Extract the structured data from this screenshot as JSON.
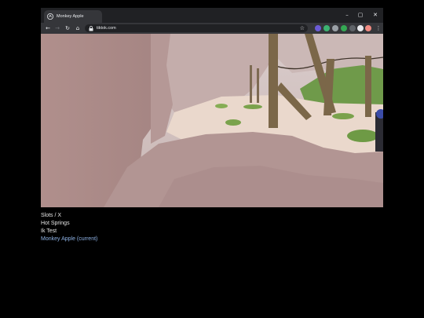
{
  "browser": {
    "tab": {
      "title": "Monkey Apple",
      "icon": "tiktok-icon"
    },
    "window_controls": {
      "minimize": "–",
      "maximize": "▢",
      "close": "✕"
    },
    "toolbar": {
      "url": "tiktok.com",
      "back_icon": "←",
      "forward_icon": "→",
      "reload_icon": "↻",
      "home_icon": "⌂",
      "bookmark_icon": "☆",
      "menu_icon": "⋮"
    },
    "extension_colors": [
      "#6b5bd6",
      "#3cb371",
      "#9aa0a6",
      "#34a853",
      "#5f6368",
      "#e8eaed",
      "#f28b82"
    ]
  },
  "menu": {
    "items": [
      {
        "label": "Slots / X",
        "current": false
      },
      {
        "label": "Hot Springs",
        "current": false
      },
      {
        "label": "Ik Test",
        "current": false
      },
      {
        "label": "Monkey Apple (current)",
        "current": true
      }
    ]
  },
  "colors": {
    "background": "#000000",
    "current_item": "#8fb3e6",
    "menu_text": "#e6e6e6"
  }
}
